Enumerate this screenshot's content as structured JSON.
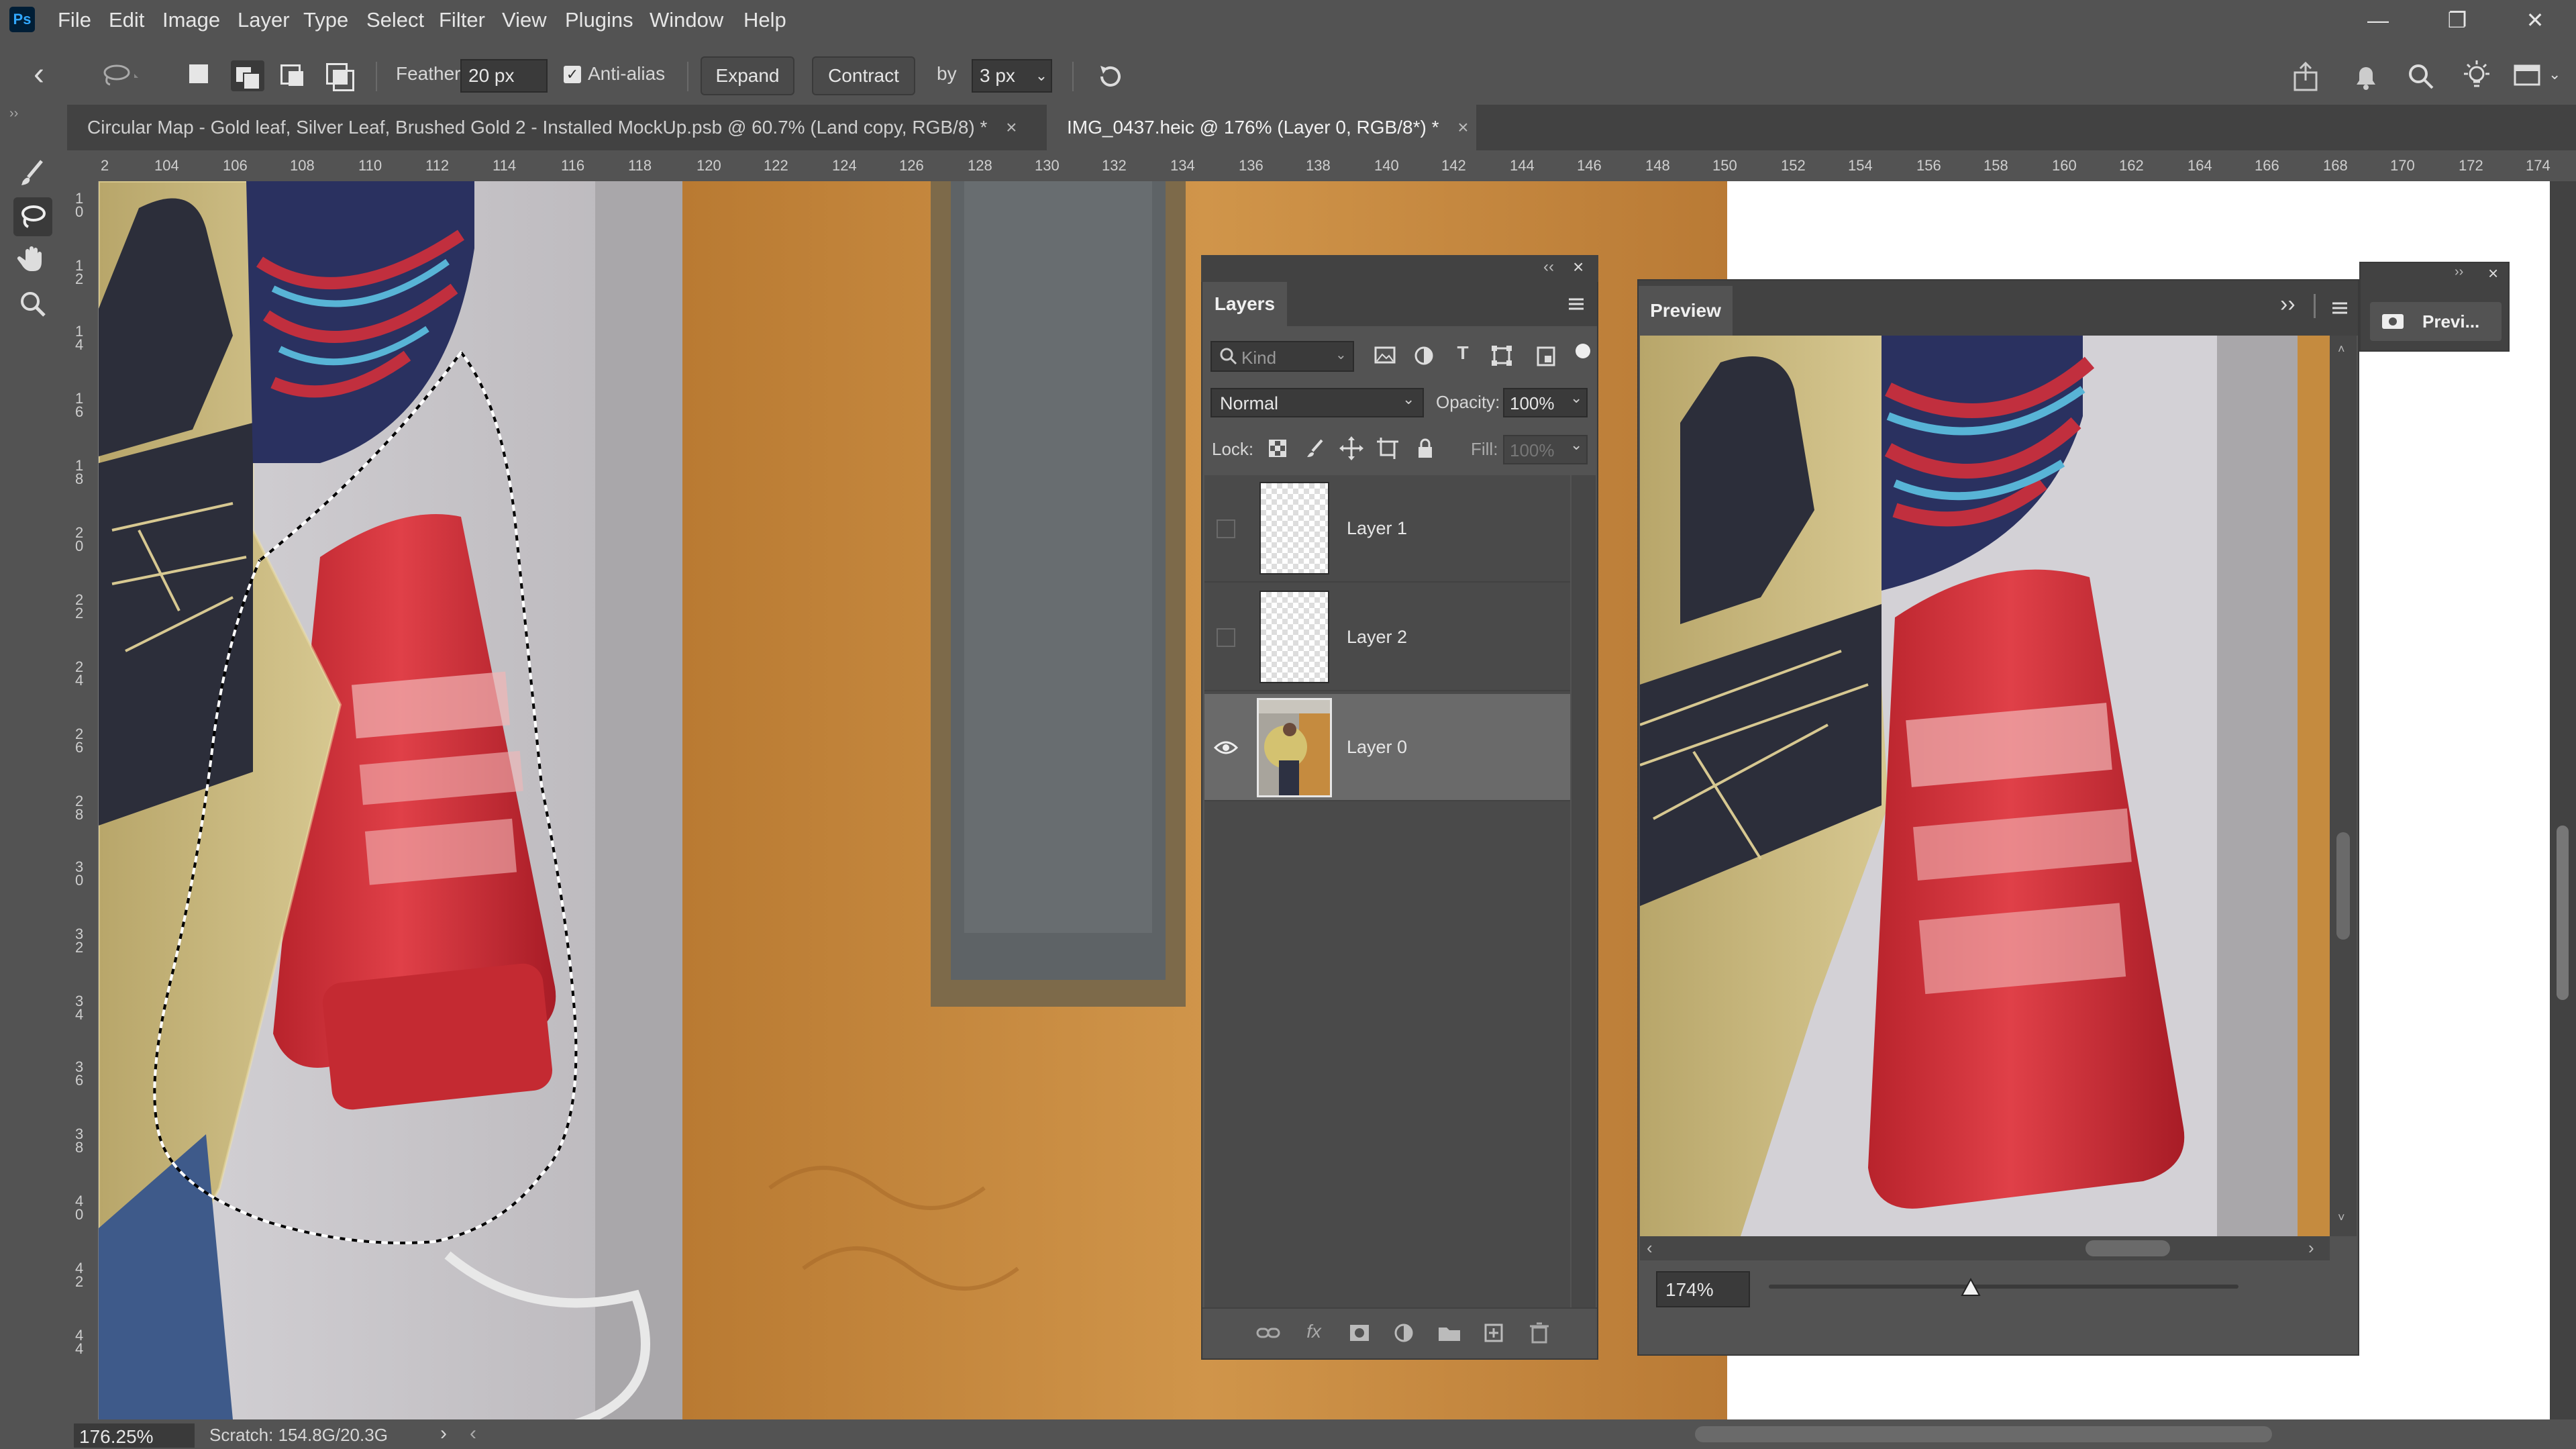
{
  "app": {
    "logo": "Ps"
  },
  "menu": [
    "File",
    "Edit",
    "Image",
    "Layer",
    "Type",
    "Select",
    "Filter",
    "View",
    "Plugins",
    "Window",
    "Help"
  ],
  "window_controls": {
    "minimize": "—",
    "restore": "❐",
    "close": "✕"
  },
  "options": {
    "back": "‹",
    "feather_label": "Feather",
    "feather_value": "20 px",
    "antialias_label": "Anti-alias",
    "expand_label": "Expand",
    "contract_label": "Contract",
    "by_label": "by",
    "by_value": "3 px"
  },
  "tabs": [
    {
      "label": "Circular Map - Gold leaf, Silver Leaf, Brushed Gold 2 - Installed MockUp.psb @ 60.7% (Land copy, RGB/8) *",
      "close": "×",
      "active": false
    },
    {
      "label": "IMG_0437.heic @ 176% (Layer 0, RGB/8*) *",
      "close": "×",
      "active": true
    }
  ],
  "ruler_top": [
    "2",
    "104",
    "106",
    "108",
    "110",
    "112",
    "114",
    "116",
    "118",
    "120",
    "122",
    "124",
    "126",
    "128",
    "130",
    "132",
    "134",
    "136",
    "138",
    "140",
    "142",
    "144",
    "146",
    "148",
    "150",
    "152",
    "154",
    "156",
    "158",
    "160",
    "162",
    "164",
    "166",
    "168",
    "170",
    "172",
    "174"
  ],
  "ruler_left": [
    "10",
    "12",
    "14",
    "16",
    "18",
    "20",
    "22",
    "24",
    "26",
    "28",
    "30",
    "32",
    "34",
    "36",
    "38",
    "40",
    "42",
    "44"
  ],
  "layers_panel": {
    "title": "Layers",
    "search_placeholder": "Kind",
    "blend_mode": "Normal",
    "opacity_label": "Opacity:",
    "opacity_value": "100%",
    "lock_label": "Lock:",
    "fill_label": "Fill:",
    "fill_value": "100%",
    "layers": [
      {
        "name": "Layer 1",
        "visible": false
      },
      {
        "name": "Layer 2",
        "visible": false
      },
      {
        "name": "Layer 0",
        "visible": true,
        "selected": true
      }
    ]
  },
  "preview_panel": {
    "title": "Preview",
    "zoom_value": "174%",
    "zoom_fraction": 0.43
  },
  "mini_panel": {
    "label": "Previ..."
  },
  "status": {
    "zoom": "176.25%",
    "scratch": "Scratch: 154.8G/20.3G",
    "arrow": "›"
  },
  "colors": {
    "ui_bg": "#535353",
    "panel_dark": "#424242",
    "door": "#c58b3f",
    "extinguisher": "#d8323a",
    "gold": "#c9b77a",
    "map_dark": "#2c2e3a"
  }
}
